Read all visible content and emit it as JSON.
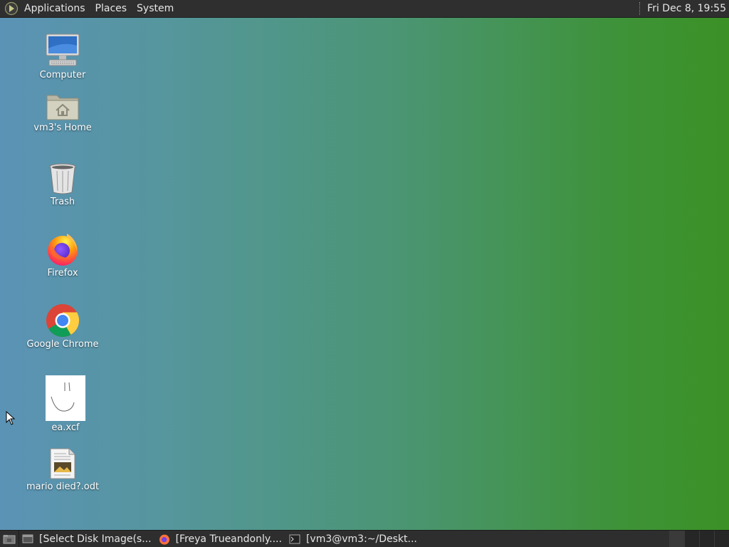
{
  "top_panel": {
    "menus": [
      "Applications",
      "Places",
      "System"
    ],
    "clock": "Fri Dec  8, 19:55"
  },
  "desktop": {
    "icons": [
      {
        "label": "Computer",
        "icon": "computer-icon"
      },
      {
        "label": "vm3's Home",
        "icon": "home-folder-icon"
      },
      {
        "label": "Trash",
        "icon": "trash-icon"
      },
      {
        "label": "Firefox",
        "icon": "firefox-icon"
      },
      {
        "label": "Google Chrome",
        "icon": "chrome-icon"
      },
      {
        "label": "ea.xcf",
        "icon": "xcf-thumbnail-icon"
      },
      {
        "label": "mario died?.odt",
        "icon": "odt-document-icon"
      }
    ]
  },
  "taskbar": {
    "tasks": [
      {
        "label": "[Select Disk Image(s...",
        "icon": "window-icon"
      },
      {
        "label": "[Freya Trueandonly....",
        "icon": "firefox-icon"
      },
      {
        "label": "[vm3@vm3:~/Deskt...",
        "icon": "terminal-icon"
      }
    ]
  },
  "colors": {
    "panel": "#2f2f2f",
    "desktop_left": "#5b93b6",
    "desktop_right": "#3b9126"
  }
}
